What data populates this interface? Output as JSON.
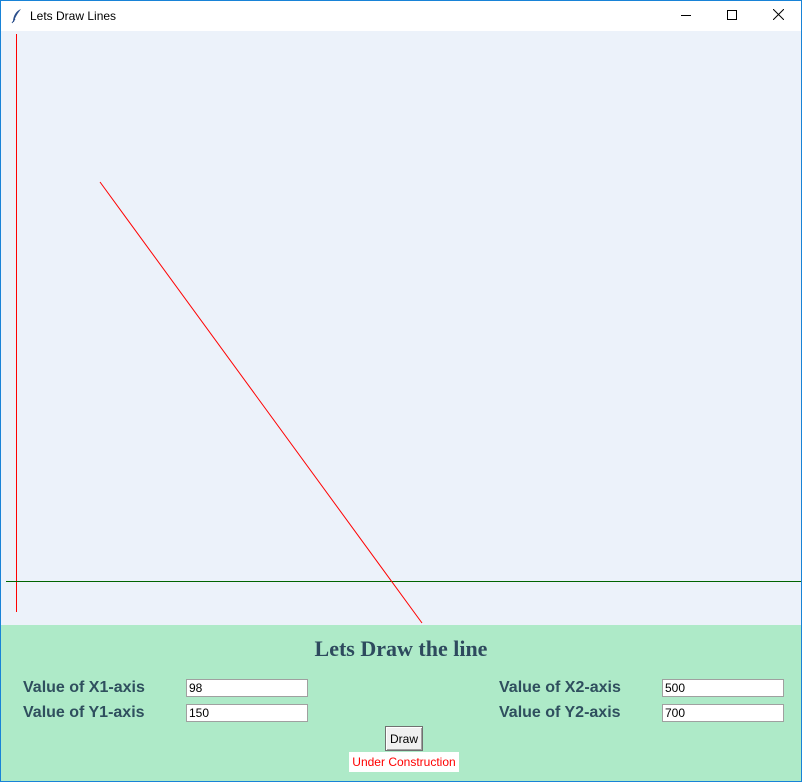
{
  "window": {
    "title": "Lets Draw Lines",
    "icon": "feather-icon"
  },
  "window_controls": [
    "minimize-icon",
    "maximize-icon",
    "close-icon"
  ],
  "canvas": {
    "background": "#ecf2fa",
    "axis_x_color": "#006400",
    "axis_y_color": "#ff0000",
    "line_color": "#ff0000"
  },
  "controls": {
    "background": "#aeeac8",
    "heading": "Lets Draw the line",
    "x1_label": "Value of X1-axis",
    "x1_value": "98",
    "y1_label": "Value of Y1-axis",
    "y1_value": "150",
    "x2_label": "Value of X2-axis",
    "x2_value": "500",
    "y2_label": "Value of Y2-axis",
    "y2_value": "700",
    "draw_label": "Draw",
    "status": "Under Construction"
  }
}
